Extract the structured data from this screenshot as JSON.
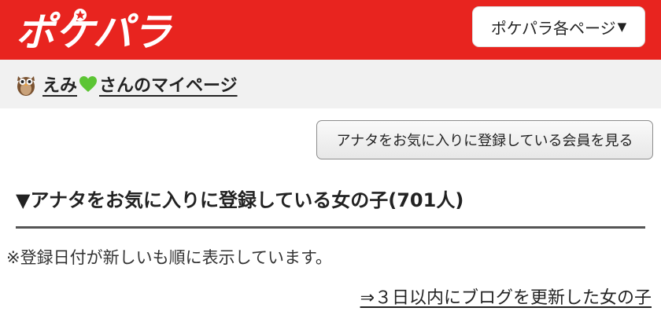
{
  "header": {
    "logo_text": "ポケパラ",
    "page_menu_label": "ポケパラ各ページ",
    "page_menu_caret": "▼",
    "colors": {
      "brand_red": "#e8241f",
      "header_button_bg": "#ffffff"
    }
  },
  "userbar": {
    "user_icon": "owl-icon",
    "user_name": "えみ",
    "heart_icon": "green-heart-icon",
    "suffix": "さんのマイページ"
  },
  "actions": {
    "fav_members_button": "アナタをお気に入りに登録している会員を見る"
  },
  "section": {
    "title": "▼アナタをお気に入りに登録している女の子(701人)",
    "sort_note": "※登録日付が新しいも順に表示しています。",
    "blog_link": "⇒３日以内にブログを更新した女の子"
  }
}
